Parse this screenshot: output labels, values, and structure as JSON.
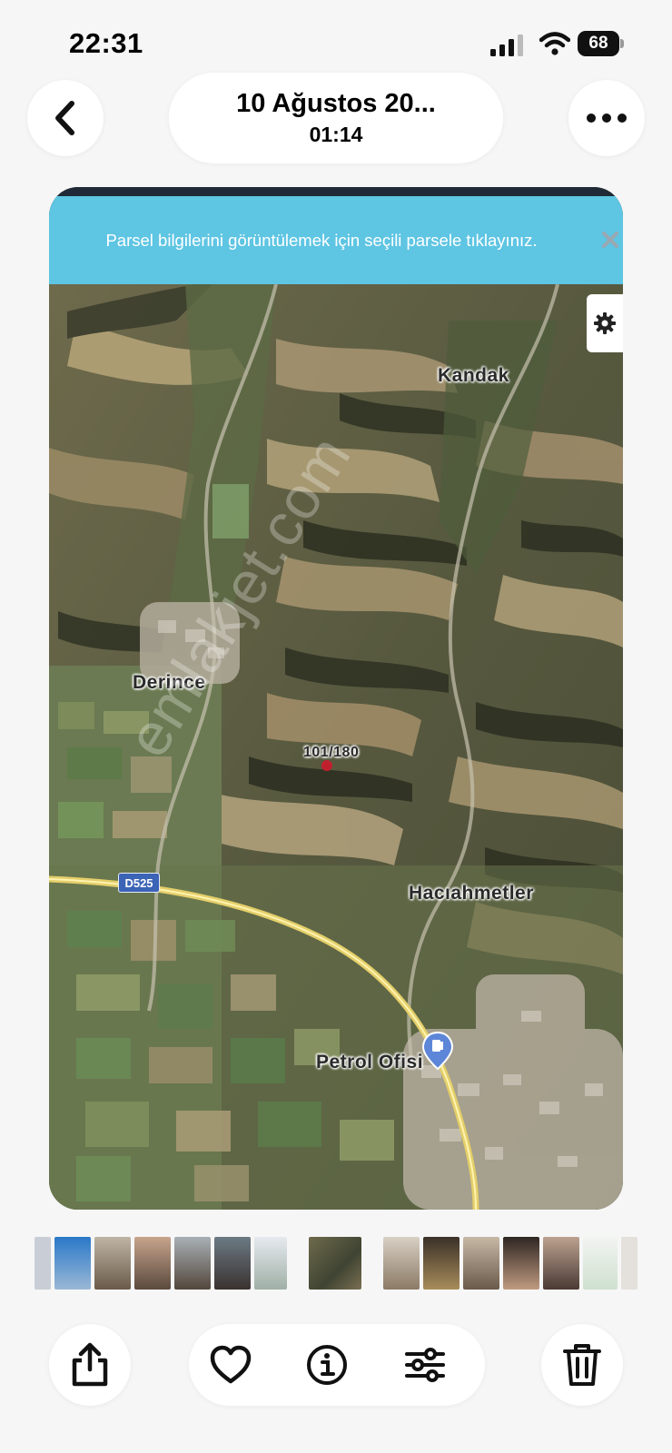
{
  "status_bar": {
    "time": "22:31",
    "battery": "68"
  },
  "header": {
    "title": "10 Ağustos 20...",
    "subtitle": "01:14"
  },
  "photo": {
    "banner_text": "Parsel bilgilerini görüntülemek için seçili parsele tıklayınız.",
    "map_labels": {
      "kandak": "Kandak",
      "derince": "Derince",
      "parcel": "101/180",
      "haciahmetler": "Hacıahmetler",
      "petrol_ofisi": "Petrol Ofisi",
      "road": "D525"
    },
    "watermark": "emlakjet.com",
    "colors": {
      "banner": "#5ec5e3",
      "parcel_marker": "#c0202e",
      "road_badge": "#3b63b6",
      "poi_pin": "#5d86d8"
    }
  },
  "icons": {
    "back": "chevron-left-icon",
    "more": "ellipsis-icon",
    "share": "share-icon",
    "favorite": "heart-icon",
    "info": "info-icon",
    "adjust": "sliders-icon",
    "delete": "trash-icon",
    "settings": "gear-icon",
    "close": "close-icon"
  }
}
